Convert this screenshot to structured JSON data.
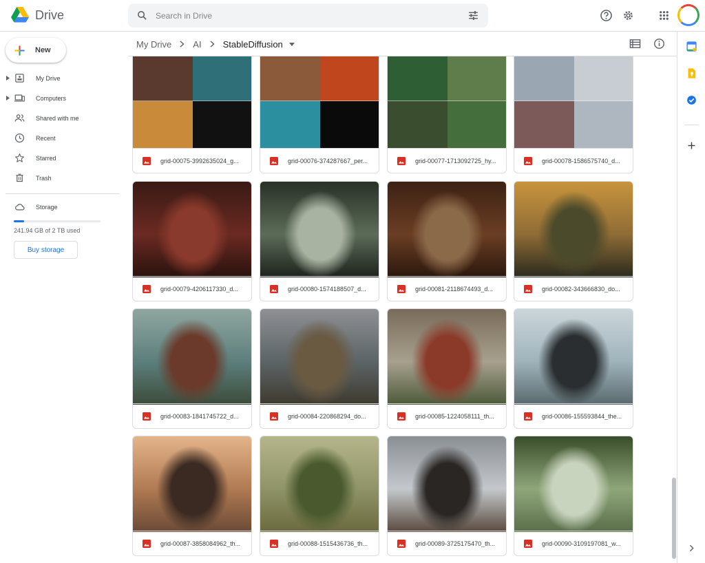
{
  "app": {
    "name": "Drive"
  },
  "search": {
    "placeholder": "Search in Drive"
  },
  "new_button": "New",
  "sidebar": {
    "items": [
      {
        "label": "My Drive",
        "icon": "my-drive-icon",
        "expandable": true
      },
      {
        "label": "Computers",
        "icon": "computers-icon",
        "expandable": true
      },
      {
        "label": "Shared with me",
        "icon": "shared-icon",
        "expandable": false
      },
      {
        "label": "Recent",
        "icon": "clock-icon",
        "expandable": false
      },
      {
        "label": "Starred",
        "icon": "star-icon",
        "expandable": false
      },
      {
        "label": "Trash",
        "icon": "trash-icon",
        "expandable": false
      }
    ],
    "storage": {
      "label": "Storage",
      "used_text": "241.94 GB of 2 TB used",
      "used_fraction": 0.12,
      "buy_label": "Buy storage"
    }
  },
  "breadcrumb": {
    "items": [
      "My Drive",
      "AI"
    ],
    "current": "StableDiffusion"
  },
  "files": [
    {
      "name": "grid-00075-3992635024_g...",
      "colors": [
        "#5a3a2e",
        "#2f6f78",
        "#c98a3a",
        "#111111"
      ]
    },
    {
      "name": "grid-00076-374287667_per...",
      "colors": [
        "#8a5a3a",
        "#c0471d",
        "#2b8fa0",
        "#0a0a0a"
      ]
    },
    {
      "name": "grid-00077-1713092725_hy...",
      "colors": [
        "#2e5e34",
        "#5f7d4a",
        "#3a4d2f",
        "#446e3c"
      ]
    },
    {
      "name": "grid-00078-1586575740_d...",
      "colors": [
        "#9aa7b2",
        "#c7cdd3",
        "#7d5a5a",
        "#aeb7bf"
      ]
    },
    {
      "name": "grid-00079-4206117330_d...",
      "colors": [
        "#6b2a22",
        "#3a1a14",
        "#8a3a2c",
        "#2a120e"
      ]
    },
    {
      "name": "grid-00080-1574188507_d...",
      "colors": [
        "#5c6b58",
        "#2a3128",
        "#a9b3a2",
        "#1e231d"
      ]
    },
    {
      "name": "grid-00081-2118674493_d...",
      "colors": [
        "#6b3e24",
        "#3d2214",
        "#8b6a4a",
        "#2b170d"
      ]
    },
    {
      "name": "grid-00082-343666830_do...",
      "colors": [
        "#8f6c36",
        "#c7943c",
        "#4b4a2a",
        "#2a2a1e"
      ]
    },
    {
      "name": "grid-00083-1841745722_d...",
      "colors": [
        "#5c7f7c",
        "#90a6a0",
        "#6b3a2a",
        "#3c4b3a"
      ]
    },
    {
      "name": "grid-00084-220868294_do...",
      "colors": [
        "#5c6466",
        "#8f9094",
        "#6a5a42",
        "#3e3a2e"
      ]
    },
    {
      "name": "grid-00085-1224058111_th...",
      "colors": [
        "#a7a08e",
        "#7a6b5a",
        "#8b3a2a",
        "#4e5a3a"
      ]
    },
    {
      "name": "grid-00086-155593844_the...",
      "colors": [
        "#9fb3bb",
        "#cbd6da",
        "#2a2e30",
        "#5a6a6e"
      ]
    },
    {
      "name": "grid-00087-3858084962_th...",
      "colors": [
        "#b07a52",
        "#e4b48a",
        "#3a2a22",
        "#6b4a36"
      ]
    },
    {
      "name": "grid-00088-1515436736_th...",
      "colors": [
        "#8f9468",
        "#b5b58a",
        "#4a5a2e",
        "#6a6a3e"
      ]
    },
    {
      "name": "grid-00089-3725175470_th...",
      "colors": [
        "#c4c8cc",
        "#8a8f93",
        "#2a2624",
        "#5a4a3e"
      ]
    },
    {
      "name": "grid-00090-3109197081_w...",
      "colors": [
        "#8fa67a",
        "#3a4d2a",
        "#c9d4bf",
        "#5a6e4a"
      ]
    }
  ],
  "colors": {
    "accent": "#1a73e8",
    "file_icon": "#d93025",
    "border": "#dadce0"
  }
}
